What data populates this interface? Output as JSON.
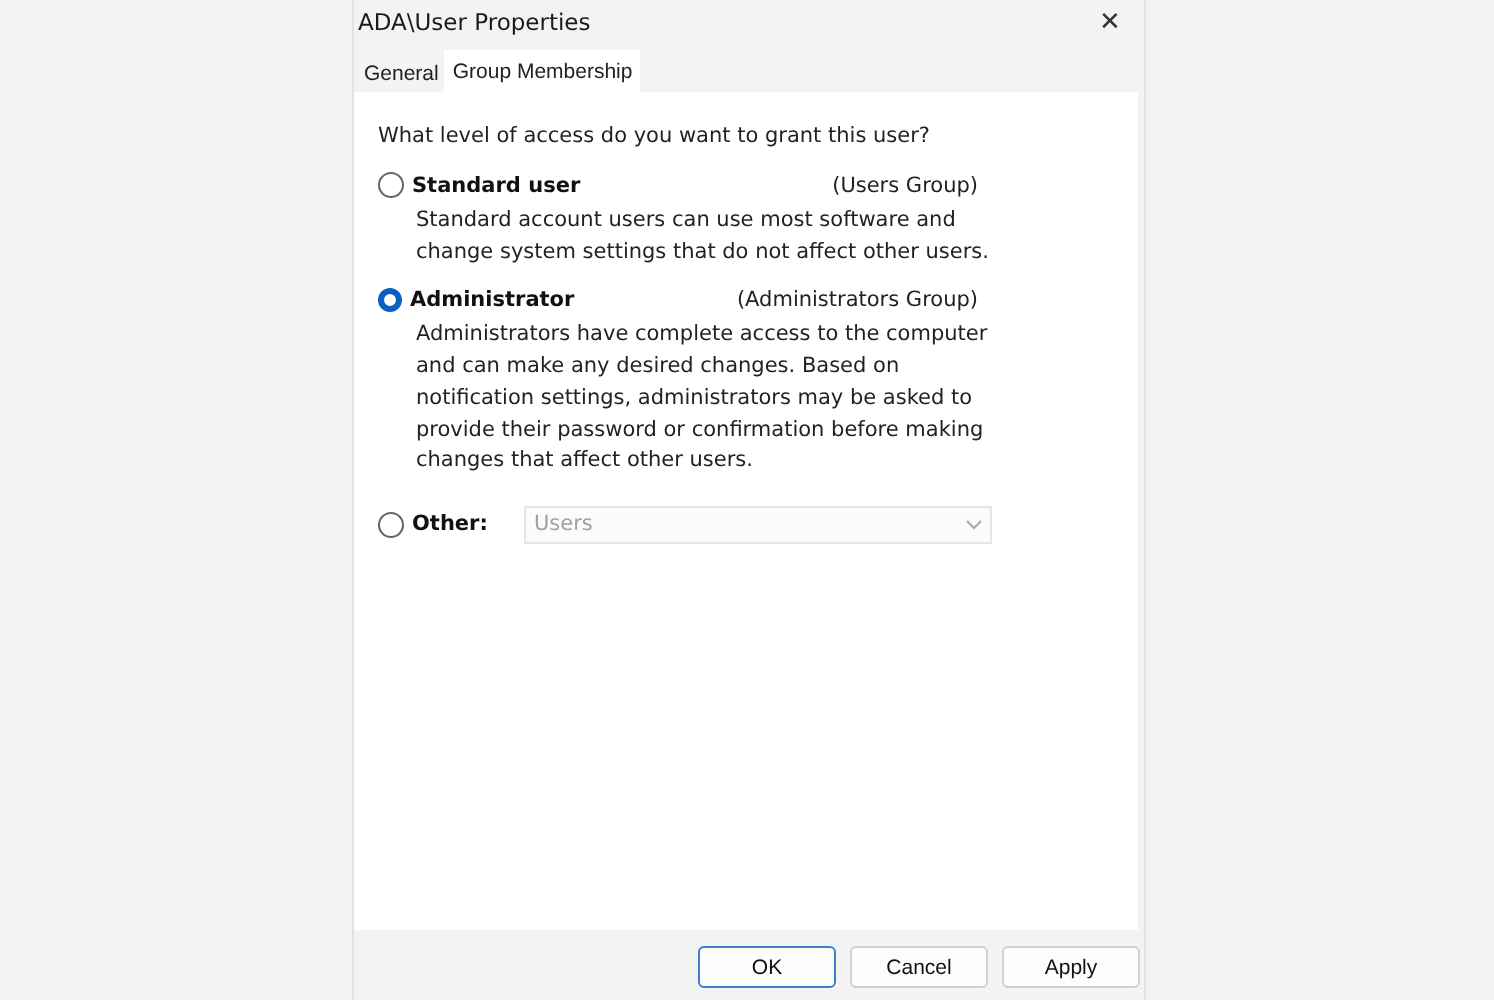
{
  "window": {
    "title": "ADA\\User Properties",
    "close": "✕"
  },
  "tabs": [
    {
      "label": "General",
      "selected": false
    },
    {
      "label": "Group Membership",
      "selected": true
    }
  ],
  "question": "What level of access do you want to grant this user?",
  "options": [
    {
      "kind": "described",
      "label": "Standard user",
      "group": "(Users Group)",
      "selected": false,
      "description": "Standard account users can use most software and change system settings that do not affect other users."
    },
    {
      "kind": "described",
      "label": "Administrator",
      "group": "(Administrators Group)",
      "selected": true,
      "description": "Administrators have complete access to the computer and can make any desired changes. Based on notification settings, administrators may be asked to provide their password or confirmation before making changes that affect other users."
    },
    {
      "kind": "dropdown",
      "label": "Other:",
      "selected": false,
      "dropdown": {
        "value": "Users",
        "disabled": true
      }
    }
  ],
  "buttons": [
    {
      "label": "OK",
      "default": true
    },
    {
      "label": "Cancel",
      "default": false
    },
    {
      "label": "Apply",
      "default": false
    }
  ]
}
